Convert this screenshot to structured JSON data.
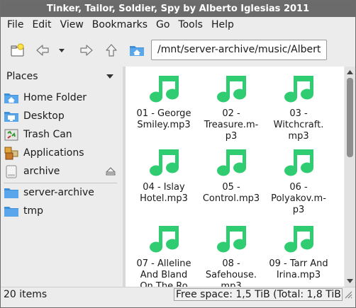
{
  "window": {
    "title": "Tinker, Tailor, Soldier, Spy by Alberto Iglesias 2011"
  },
  "menubar": {
    "items": [
      "File",
      "Edit",
      "View",
      "Bookmarks",
      "Go",
      "Tools",
      "Help"
    ]
  },
  "toolbar": {
    "location": "/mnt/server-archive/music/Albert"
  },
  "sidebar": {
    "header": "Places",
    "items": [
      {
        "label": "Home Folder",
        "icon": "home-folder-icon"
      },
      {
        "label": "Desktop",
        "icon": "desktop-folder-icon"
      },
      {
        "label": "Trash Can",
        "icon": "trash-icon"
      },
      {
        "label": "Applications",
        "icon": "applications-icon"
      },
      {
        "label": "archive",
        "icon": "drive-icon"
      },
      {
        "label": "server-archive",
        "icon": "folder-icon"
      },
      {
        "label": "tmp",
        "icon": "folder-icon"
      }
    ]
  },
  "files": [
    {
      "name": "01 - George Smiley.mp3"
    },
    {
      "name": "02 - Treasure.m-p3"
    },
    {
      "name": "03 - Witchcraft. mp3"
    },
    {
      "name": "04 - Islay Hotel.mp3"
    },
    {
      "name": "05 - Control.mp3"
    },
    {
      "name": "06 - Polyakov.m-p3"
    },
    {
      "name": "07 - Alleline And Bland On The Ro"
    },
    {
      "name": "08 - Safehouse. mp3"
    },
    {
      "name": "09 - Tarr And Irina.mp3"
    }
  ],
  "statusbar": {
    "items_count": "20 items",
    "free_space": "Free space: 1,5 TiB (Total: 1,8 TiB)"
  },
  "colors": {
    "music_icon": "#2fcc71",
    "folder_blue": "#3f8fd8",
    "titlebar": "#6b6b6b"
  }
}
